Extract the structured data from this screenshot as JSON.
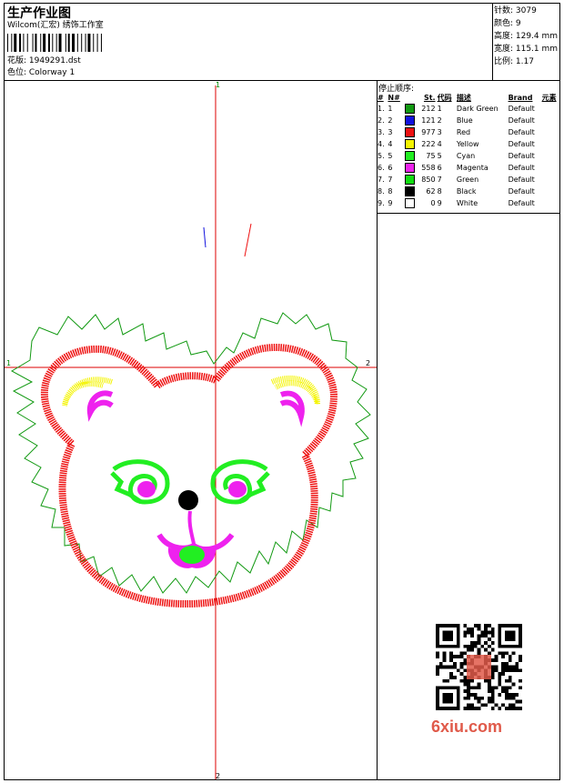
{
  "header": {
    "title": "生产作业图",
    "company": "Wilcom(汇宏) 绣饰工作室",
    "pattern_label": "花版: 1949291.dst",
    "colorway_label": "色位: Colorway 1"
  },
  "stats": {
    "stitches": "针数: 3079",
    "colors": "颜色: 9",
    "height": "高度: 129.4 mm",
    "width": "宽度: 115.1 mm",
    "scale": "比例: 1.17"
  },
  "stop_sequence": {
    "title": "停止顺序:",
    "headers": [
      "#",
      "N#",
      "St.",
      "代码",
      "描述",
      "Brand",
      "元素"
    ],
    "rows": [
      {
        "num": "1.",
        "n": "1",
        "color": "#119911",
        "st": "212",
        "code": "1",
        "desc": "Dark Green",
        "brand": "Default"
      },
      {
        "num": "2.",
        "n": "2",
        "color": "#1111dd",
        "st": "121",
        "code": "2",
        "desc": "Blue",
        "brand": "Default"
      },
      {
        "num": "3.",
        "n": "3",
        "color": "#ee1111",
        "st": "977",
        "code": "3",
        "desc": "Red",
        "brand": "Default"
      },
      {
        "num": "4.",
        "n": "4",
        "color": "#f4f400",
        "st": "222",
        "code": "4",
        "desc": "Yellow",
        "brand": "Default"
      },
      {
        "num": "5.",
        "n": "5",
        "color": "#22ee22",
        "st": "75",
        "code": "5",
        "desc": "Cyan",
        "brand": "Default"
      },
      {
        "num": "6.",
        "n": "6",
        "color": "#ee22ee",
        "st": "558",
        "code": "6",
        "desc": "Magenta",
        "brand": "Default"
      },
      {
        "num": "7.",
        "n": "7",
        "color": "#11dd11",
        "st": "850",
        "code": "7",
        "desc": "Green",
        "brand": "Default"
      },
      {
        "num": "8.",
        "n": "8",
        "color": "#000000",
        "st": "62",
        "code": "8",
        "desc": "Black",
        "brand": "Default"
      },
      {
        "num": "9.",
        "n": "9",
        "color": "#ffffff",
        "st": "0",
        "code": "9",
        "desc": "White",
        "brand": "Default"
      }
    ]
  },
  "axis_labels": {
    "top": "1",
    "bottom": "2",
    "left": "1",
    "right": "2"
  },
  "watermark": "6xiu.com",
  "colors": {
    "red": "#ee1111",
    "green_outline": "#119911",
    "yellow": "#f4f400",
    "magenta": "#ee22ee",
    "green": "#22ee22",
    "blue": "#1111dd",
    "crosshair": "#dd0000"
  },
  "icons": {
    "qr": "qr-code-icon"
  }
}
